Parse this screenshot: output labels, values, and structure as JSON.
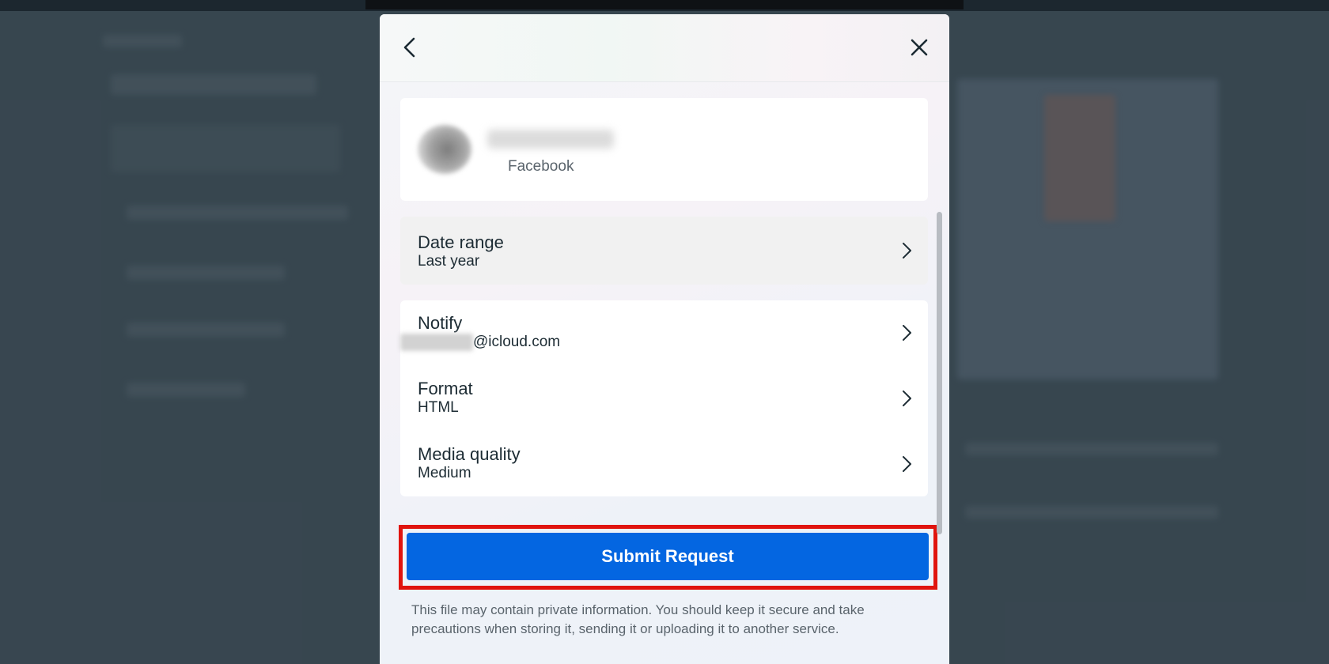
{
  "modal": {
    "account": {
      "platform": "Facebook"
    },
    "date_range": {
      "title": "Date range",
      "value": "Last year"
    },
    "notify": {
      "title": "Notify",
      "value": "@icloud.com"
    },
    "format": {
      "title": "Format",
      "value": "HTML"
    },
    "media_quality": {
      "title": "Media quality",
      "value": "Medium"
    },
    "submit_label": "Submit Request",
    "disclaimer": "This file may contain private information. You should keep it secure and take precautions when storing it, sending it or uploading it to another service."
  },
  "icons": {
    "back": "chevron-left-icon",
    "close": "close-icon",
    "row_chevron": "chevron-right-icon"
  },
  "colors": {
    "submit_button": "#0466e1",
    "highlight_outline": "#e0140e",
    "overlay": "#3b4a55"
  }
}
